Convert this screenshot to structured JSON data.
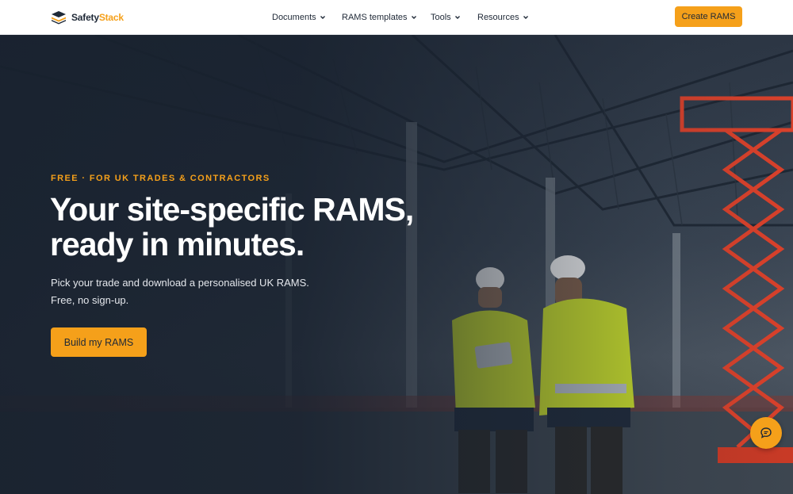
{
  "brand": {
    "name_part1": "Safety",
    "name_part2": "Stack",
    "accent_color": "#f5a01a"
  },
  "nav": {
    "items": [
      {
        "label": "Documents",
        "icon": "chevron-down-icon"
      },
      {
        "label": "RAMS templates",
        "icon": "chevron-down-icon"
      },
      {
        "label": "Tools",
        "icon": "chevron-down-icon"
      },
      {
        "label": "Resources",
        "icon": "chevron-down-icon"
      }
    ],
    "cta_label": "Create RAMS"
  },
  "hero": {
    "eyebrow": "FREE · FOR UK TRADES & CONTRACTORS",
    "headline_line1": "Your site-specific RAMS,",
    "headline_line2": "ready in minutes.",
    "subtext_line1": "Pick your trade and download a personalised UK RAMS.",
    "subtext_line2": "Free, no sign-up.",
    "cta_label": "Build my RAMS",
    "background_image": "construction-site-workers-photo"
  },
  "chat": {
    "icon": "chat-bubble-icon"
  }
}
